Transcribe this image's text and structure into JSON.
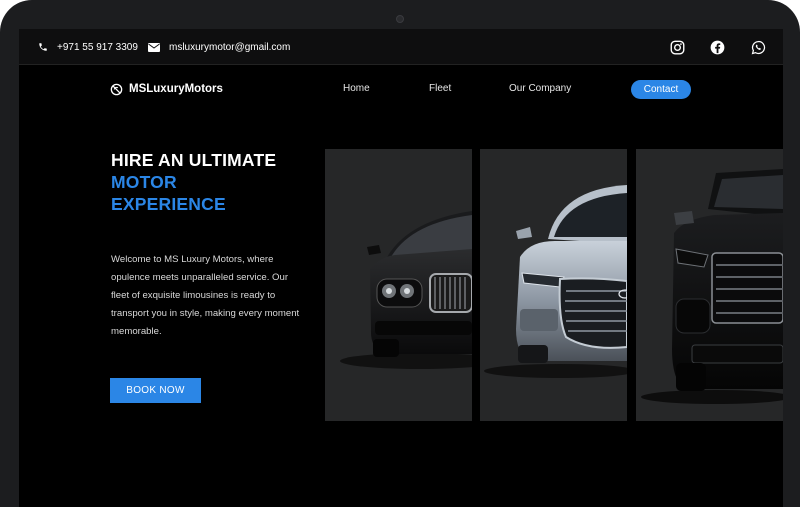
{
  "topbar": {
    "phone": "+971 55 917 3309",
    "email": "msluxurymotor@gmail.com",
    "socials": [
      "instagram-icon",
      "facebook-icon",
      "whatsapp-icon"
    ]
  },
  "nav": {
    "brand": "MSLuxuryMotors",
    "links": [
      "Home",
      "Fleet",
      "Our Company"
    ],
    "contact_label": "Contact"
  },
  "hero": {
    "title_line1": "HIRE AN ULTIMATE",
    "title_line2": "MOTOR",
    "title_line3": "EXPERIENCE",
    "description": "Welcome to MS Luxury Motors, where opulence meets unparalleled service. Our fleet of exquisite limousines is ready to transport you in style, making every moment memorable.",
    "cta_label": "BOOK NOW"
  },
  "colors": {
    "accent": "#2b86e6",
    "background": "#000000",
    "panel": "#262728"
  }
}
